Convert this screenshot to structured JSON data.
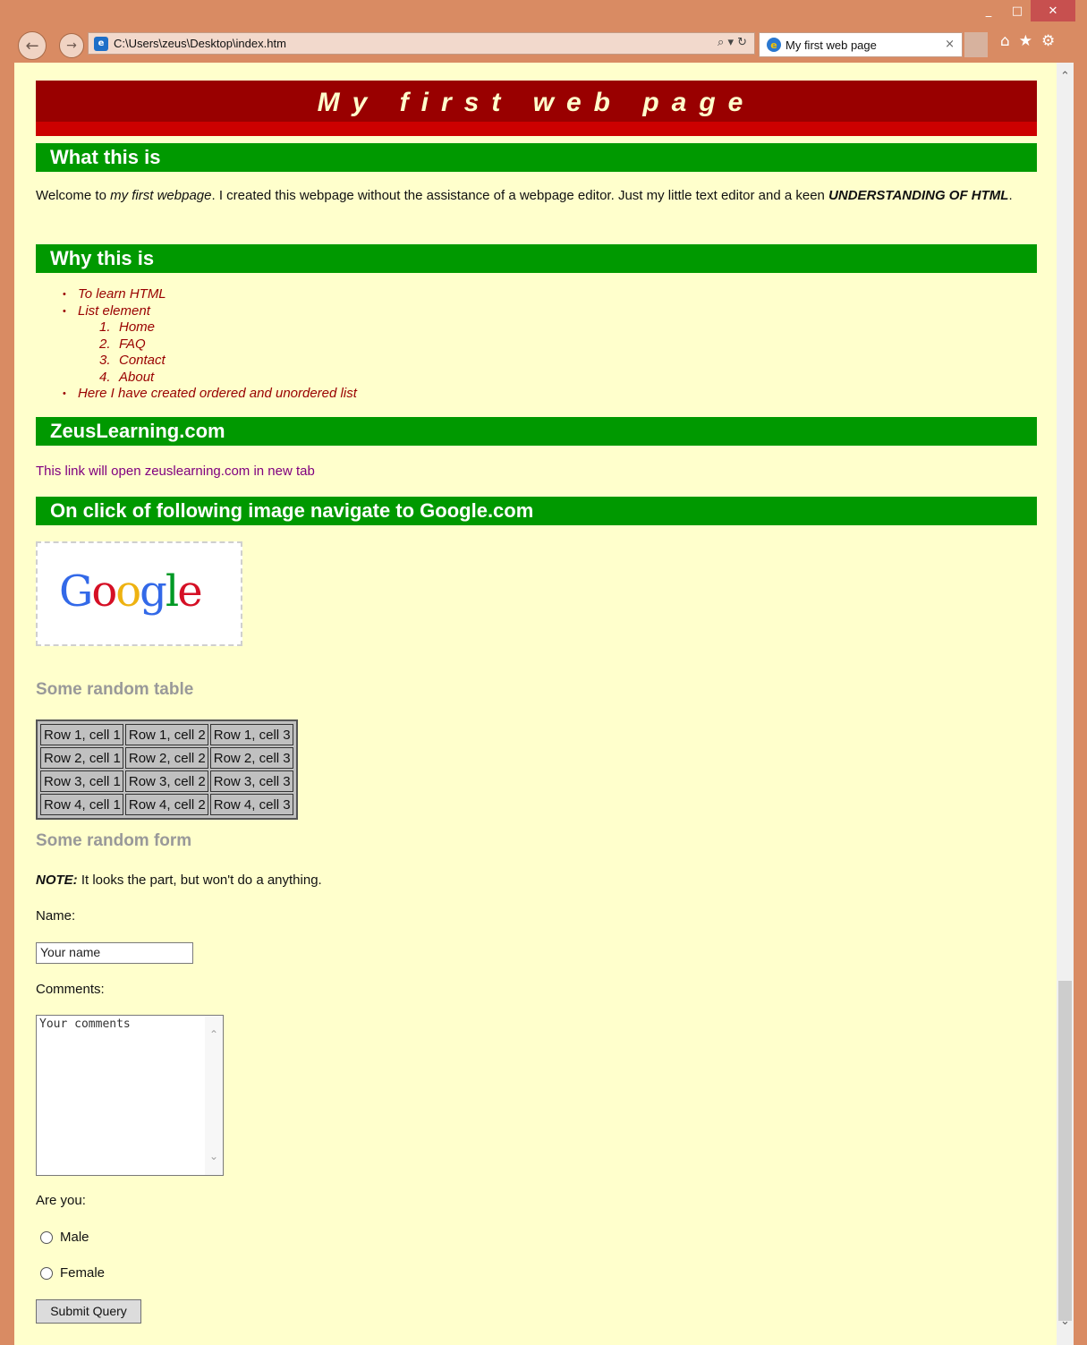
{
  "browser": {
    "window_controls": {
      "minimize": "_",
      "maximize": "□",
      "close": "✕"
    },
    "nav": {
      "back_icon": "back-arrow-icon",
      "forward_icon": "forward-arrow-icon"
    },
    "address": "C:\\Users\\zeus\\Desktop\\index.htm",
    "address_tools": "⌕ ▾ ↻",
    "tab": {
      "title": "My first web page",
      "close": "×"
    },
    "tools": {
      "home": "⌂",
      "favorites": "★",
      "settings": "⚙"
    }
  },
  "page": {
    "banner_title": "My first web page",
    "sections": {
      "what": {
        "heading": "What this is",
        "text_1": "Welcome to ",
        "text_em": "my first webpage",
        "text_2": ". I created this webpage without the assistance of a webpage editor. Just my little text editor and a keen ",
        "text_strong": "UNDERSTANDING OF HTML",
        "text_3": "."
      },
      "why": {
        "heading": "Why this is",
        "bullets": [
          "To learn HTML",
          "List element",
          "Here I have created ordered and unordered list"
        ],
        "ordered": [
          "Home",
          "FAQ",
          "Contact",
          "About"
        ]
      },
      "zeus": {
        "heading": "ZeusLearning.com",
        "link_text": "This link will open zeuslearning.com in new tab"
      },
      "google": {
        "heading": "On click of following image navigate to Google.com",
        "logo_letters": [
          "G",
          "o",
          "o",
          "g",
          "l",
          "e"
        ]
      },
      "table": {
        "heading": "Some random table",
        "rows": [
          [
            "Row 1, cell 1",
            "Row 1, cell 2",
            "Row 1, cell 3"
          ],
          [
            "Row 2, cell 1",
            "Row 2, cell 2",
            "Row 2, cell 3"
          ],
          [
            "Row 3, cell 1",
            "Row 3, cell 2",
            "Row 3, cell 3"
          ],
          [
            "Row 4, cell 1",
            "Row 4, cell 2",
            "Row 4, cell 3"
          ]
        ]
      },
      "form": {
        "heading": "Some random form",
        "note_label": "NOTE:",
        "note_text": " It looks the part, but won't do a anything.",
        "name_label": "Name:",
        "name_value": "Your name",
        "comments_label": "Comments:",
        "comments_value": "Your comments",
        "are_you_label": "Are you:",
        "radio_male": "Male",
        "radio_female": "Female",
        "submit_label": "Submit Query"
      }
    }
  },
  "colors": {
    "window_frame": "#d98b63",
    "page_bg": "#ffffcc",
    "banner_dark": "#990000",
    "banner_red": "#cc0000",
    "section_green": "#009900",
    "list_text": "#990000",
    "link_visited": "#800080",
    "gray_heading": "#999999",
    "google": [
      "#3369e8",
      "#d50f25",
      "#eeb211",
      "#3369e8",
      "#009925",
      "#d50f25"
    ]
  }
}
